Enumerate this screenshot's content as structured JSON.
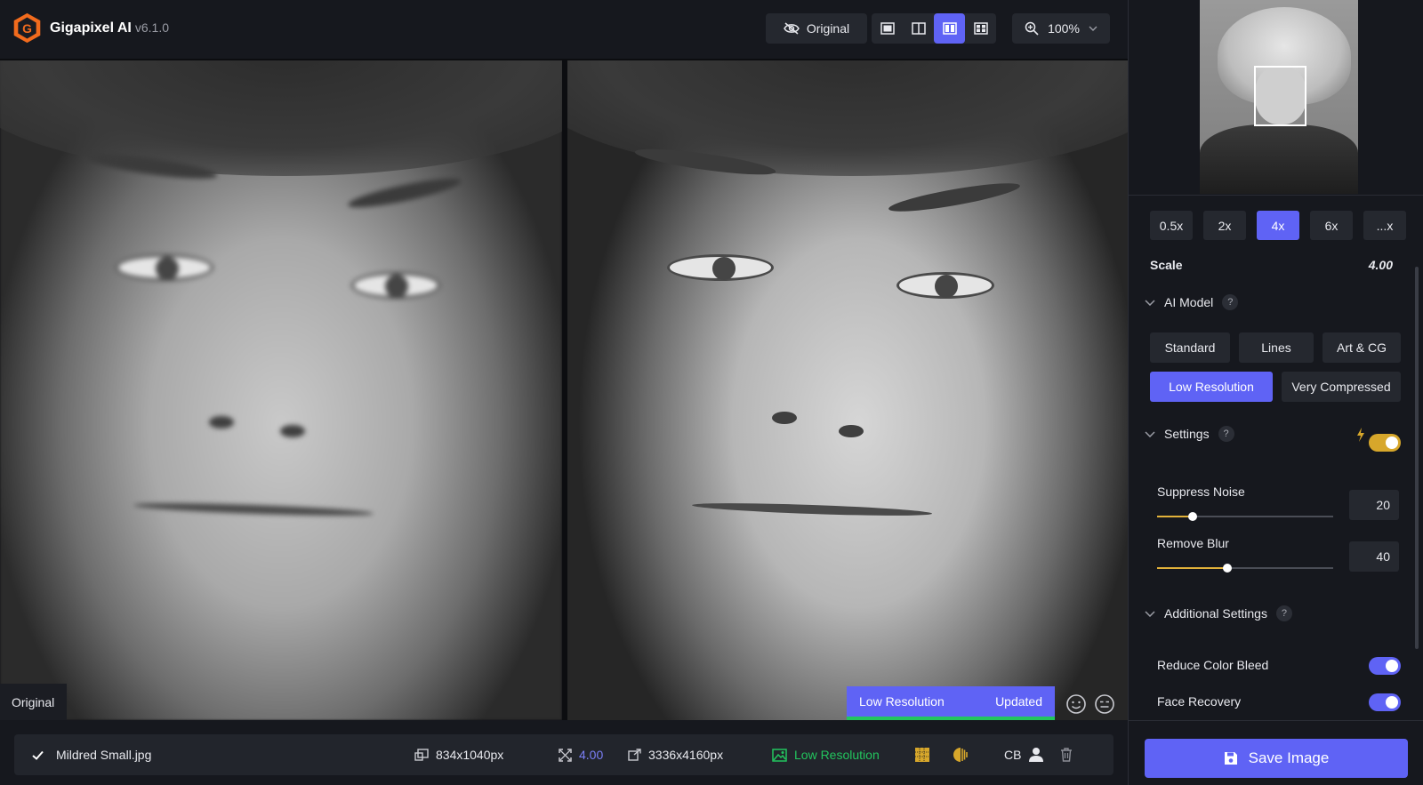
{
  "app": {
    "name": "Gigapixel AI",
    "version": "v6.1.0"
  },
  "toolbar": {
    "original_label": "Original",
    "zoom_label": "100%"
  },
  "viewer": {
    "left_label": "Original",
    "model_tag": "Low Resolution",
    "status_tag": "Updated"
  },
  "file": {
    "name": "Mildred Small.jpg",
    "input_size": "834x1040px",
    "scale": "4.00",
    "output_size": "3336x4160px",
    "model": "Low Resolution",
    "cb_label": "CB"
  },
  "panel": {
    "scale_options": [
      "0.5x",
      "2x",
      "4x",
      "6x",
      "...x"
    ],
    "scale_label": "Scale",
    "scale_value": "4.00",
    "ai_model_label": "AI Model",
    "help": "?",
    "models": [
      "Standard",
      "Lines",
      "Art & CG",
      "Low Resolution",
      "Very Compressed"
    ],
    "settings_label": "Settings",
    "suppress_noise_label": "Suppress Noise",
    "suppress_noise_value": "20",
    "remove_blur_label": "Remove Blur",
    "remove_blur_value": "40",
    "additional_label": "Additional Settings",
    "reduce_color_bleed_label": "Reduce Color Bleed",
    "face_recovery_label": "Face Recovery",
    "save_label": "Save Image"
  },
  "colors": {
    "accent": "#5f63f5",
    "success": "#22c55e",
    "toggle_yellow": "#d7a72b",
    "model_green": "#22c55e"
  },
  "icons": [
    "eye-off-icon",
    "single-view-icon",
    "split-view-icon",
    "side-by-side-icon",
    "grid-view-icon",
    "zoom-icon",
    "chevron-down-icon",
    "check-icon",
    "input-size-icon",
    "scale-icon",
    "output-size-icon",
    "image-model-icon",
    "grid-overlay-icon",
    "contrast-icon",
    "person-icon",
    "trash-icon",
    "face-smile-icon",
    "face-neutral-icon",
    "lightning-icon",
    "save-disk-icon"
  ]
}
